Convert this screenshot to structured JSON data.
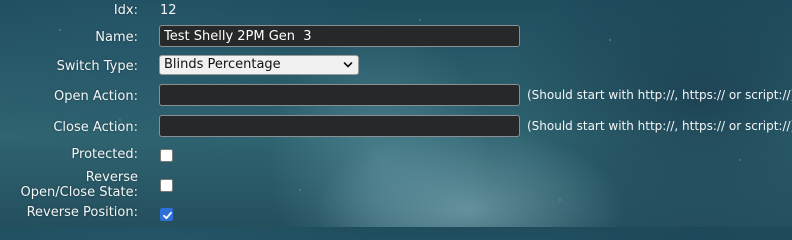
{
  "form": {
    "idx": {
      "label": "Idx:",
      "value": "12"
    },
    "name": {
      "label": "Name:",
      "value": "Test Shelly 2PM Gen  3"
    },
    "switch_type": {
      "label": "Switch Type:",
      "selected": "Blinds Percentage",
      "icon": "chevron-down-icon"
    },
    "open_action": {
      "label": "Open Action:",
      "value": "",
      "hint": "(Should start with http://, https:// or script://)"
    },
    "close_action": {
      "label": "Close Action:",
      "value": "",
      "hint": "(Should start with http://, https:// or script://)"
    },
    "protected": {
      "label": "Protected:",
      "checked": false
    },
    "reverse_state": {
      "label": "Reverse Open/Close State:",
      "checked": false
    },
    "reverse_position": {
      "label": "Reverse Position:",
      "checked": true,
      "icon": "checkmark-icon"
    }
  },
  "colors": {
    "checkbox_checked": "#2e6fd8",
    "input_background": "#272829"
  }
}
